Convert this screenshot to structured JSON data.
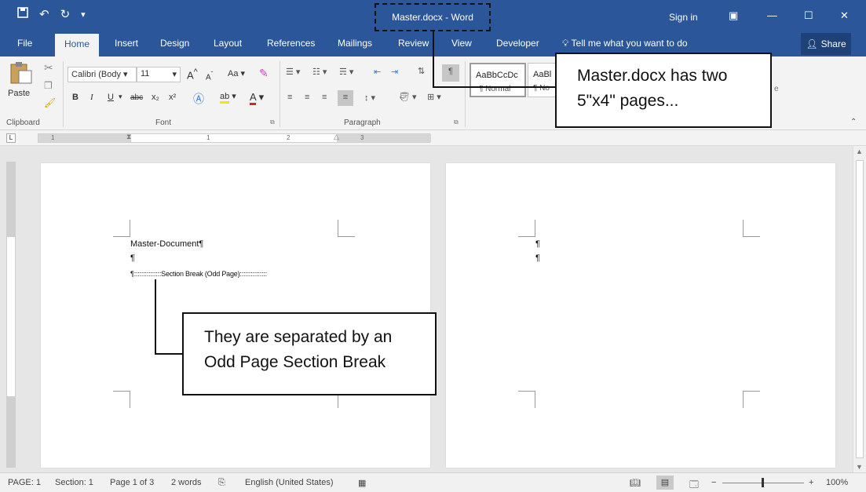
{
  "titlebar": {
    "qat": {
      "save_icon": "save-icon",
      "undo": "↶",
      "redo": "↻",
      "customize": "▾"
    },
    "title": "Master.docx  -  Word",
    "sign_in": "Sign in",
    "controls": {
      "ribbon_display": "▣",
      "minimize": "—",
      "maximize": "☐",
      "close": "✕"
    }
  },
  "tabs": [
    "File",
    "Home",
    "Insert",
    "Design",
    "Layout",
    "References",
    "Mailings",
    "Review",
    "View",
    "Developer"
  ],
  "tell_me": "Tell me what you want to do",
  "share": "Share",
  "ribbon": {
    "clipboard": {
      "paste": "Paste",
      "label": "Clipboard"
    },
    "font": {
      "name": "Calibri (Body",
      "size": "11",
      "bold": "B",
      "italic": "I",
      "underline": "U",
      "strike": "abc",
      "sub": "x₂",
      "sup": "x²",
      "grow": "A",
      "shrink": "A",
      "case": "Aa",
      "label": "Font"
    },
    "paragraph": {
      "label": "Paragraph"
    },
    "styles": [
      {
        "preview": "AaBbCcDc",
        "name": "¶ Normal"
      },
      {
        "preview": "AaBl",
        "name": "¶ No"
      }
    ]
  },
  "ruler": {
    "ticks": [
      "1",
      "1",
      "2",
      "3"
    ]
  },
  "document": {
    "page1": {
      "line1": "Master-Document¶",
      "line2": "¶",
      "line3": "¶:::::::::::::::Section Break (Odd Page):::::::::::::::"
    },
    "page2": {
      "line1": "¶",
      "line2": "¶"
    }
  },
  "statusbar": {
    "page": "PAGE: 1",
    "section": "Section: 1",
    "page_of": "Page 1 of 3",
    "words": "2 words",
    "language": "English (United States)",
    "zoom": "100%",
    "zoom_minus": "−",
    "zoom_plus": "+"
  },
  "callouts": {
    "top": {
      "line1": "Master.docx has two",
      "line2": "5\"x4\" pages..."
    },
    "bottom": {
      "line1": "They are separated by an",
      "line2": "Odd Page Section Break"
    }
  }
}
